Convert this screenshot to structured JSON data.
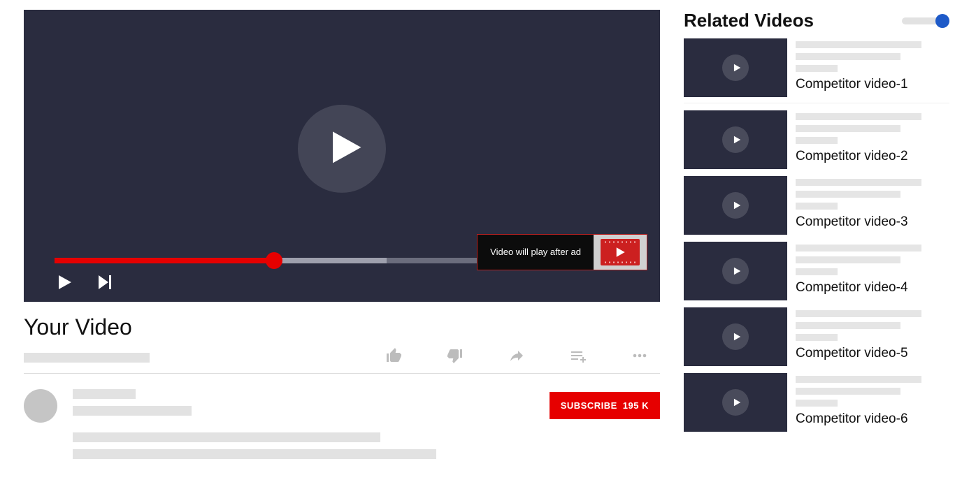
{
  "player": {
    "ad_message": "Video will play after ad",
    "progress_percent": 37,
    "buffer_percent": 56
  },
  "video": {
    "title": "Your Video"
  },
  "subscribe": {
    "label": "SUBSCRIBE",
    "count": "195 K"
  },
  "sidebar": {
    "title": "Related Videos",
    "items": [
      {
        "caption": "Competitor video-1"
      },
      {
        "caption": "Competitor video-2"
      },
      {
        "caption": "Competitor video-3"
      },
      {
        "caption": "Competitor video-4"
      },
      {
        "caption": "Competitor video-5"
      },
      {
        "caption": "Competitor video-6"
      }
    ]
  }
}
